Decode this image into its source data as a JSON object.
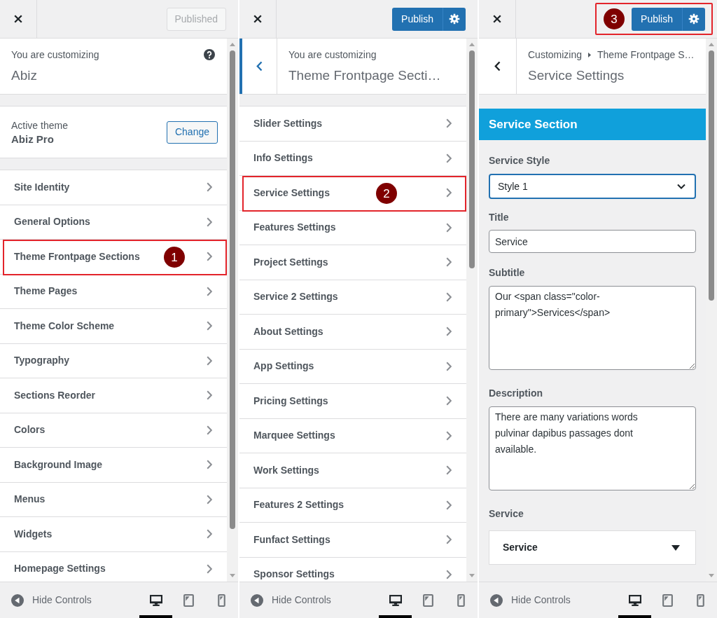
{
  "panels": [
    {
      "header": {
        "publish": {
          "label": "Published",
          "disabled": true,
          "settings": false
        }
      },
      "info": {
        "caption": "You are customizing",
        "title": "Abiz",
        "help": true
      },
      "theme": {
        "caption": "Active theme",
        "name": "Abiz Pro",
        "button": "Change"
      },
      "items": [
        {
          "label": "Site Identity"
        },
        {
          "label": "General Options"
        },
        {
          "label": "Theme Frontpage Sections",
          "callout": "1"
        },
        {
          "label": "Theme Pages"
        },
        {
          "label": "Theme Color Scheme"
        },
        {
          "label": "Typography"
        },
        {
          "label": "Sections Reorder"
        },
        {
          "label": "Colors"
        },
        {
          "label": "Background Image"
        },
        {
          "label": "Menus"
        },
        {
          "label": "Widgets"
        },
        {
          "label": "Homepage Settings"
        }
      ],
      "footer": {
        "label": "Hide Controls",
        "devices": [
          {
            "kind": "desktop",
            "selected": true
          },
          {
            "kind": "tablet",
            "selected": false
          },
          {
            "kind": "mobile",
            "selected": false
          }
        ]
      }
    },
    {
      "header": {
        "publish": {
          "label": "Publish",
          "disabled": false,
          "settings": true
        }
      },
      "info": {
        "back": {
          "highlighted": true
        },
        "caption": "You are customizing",
        "title": "Theme Frontpage Secti…"
      },
      "items": [
        {
          "label": "Slider Settings"
        },
        {
          "label": "Info Settings"
        },
        {
          "label": "Service Settings",
          "callout": "2"
        },
        {
          "label": "Features Settings"
        },
        {
          "label": "Project Settings"
        },
        {
          "label": "Service 2 Settings"
        },
        {
          "label": "About Settings"
        },
        {
          "label": "App Settings"
        },
        {
          "label": "Pricing Settings"
        },
        {
          "label": "Marquee Settings"
        },
        {
          "label": "Work Settings"
        },
        {
          "label": "Features 2 Settings"
        },
        {
          "label": "Funfact Settings"
        },
        {
          "label": "Sponsor Settings"
        }
      ],
      "footer": {
        "label": "Hide Controls",
        "devices": [
          {
            "kind": "desktop",
            "selected": true
          },
          {
            "kind": "tablet",
            "selected": false
          },
          {
            "kind": "mobile",
            "selected": false
          }
        ]
      }
    },
    {
      "header": {
        "publish": {
          "label": "Publish",
          "disabled": false,
          "settings": true
        },
        "callout": "3"
      },
      "info": {
        "back": {
          "highlighted": false
        },
        "breadcrumb": [
          "Customizing",
          "Theme Frontpage S…"
        ],
        "title": "Service Settings"
      },
      "form": {
        "heading": "Service Section",
        "controls": [
          {
            "kind": "select",
            "label": "Service Style",
            "value": "Style 1",
            "focused": true
          },
          {
            "kind": "text",
            "label": "Title",
            "value": "Service"
          },
          {
            "kind": "textarea",
            "label": "Subtitle",
            "value": "Our <span class=\"color-primary\">Services</span>"
          },
          {
            "kind": "textarea",
            "label": "Description",
            "value": "There are many variations words pulvinar dapibus passages dont available."
          },
          {
            "kind": "repeater",
            "label": "Service",
            "items": [
              {
                "title": "Service",
                "expanded": false
              }
            ]
          }
        ]
      },
      "footer": {
        "label": "Hide Controls",
        "devices": [
          {
            "kind": "desktop",
            "selected": true
          },
          {
            "kind": "tablet",
            "selected": false
          },
          {
            "kind": "mobile",
            "selected": false
          }
        ]
      }
    }
  ]
}
